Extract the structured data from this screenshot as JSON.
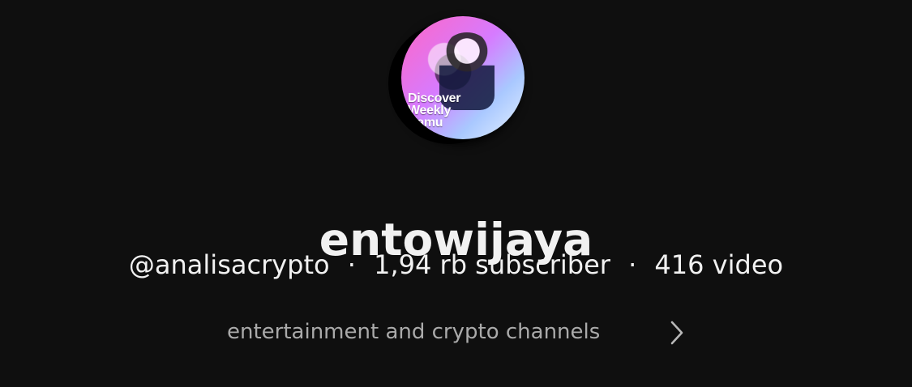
{
  "channel": {
    "avatar": {
      "icon": "channel-avatar",
      "text_lines": [
        "Discover",
        "Weekly",
        "Kamu"
      ]
    },
    "name": "entowijaya",
    "handle": "@analisacrypto",
    "separator": "·",
    "subscribers": "1,94 rb subscriber",
    "videos": "416 video",
    "description": "entertainment and crypto channels",
    "more_icon": "chevron-right-icon"
  },
  "colors": {
    "background": "#0f0f0f",
    "primary_text": "#f1f1f1",
    "secondary_text": "#aaaaaa"
  }
}
